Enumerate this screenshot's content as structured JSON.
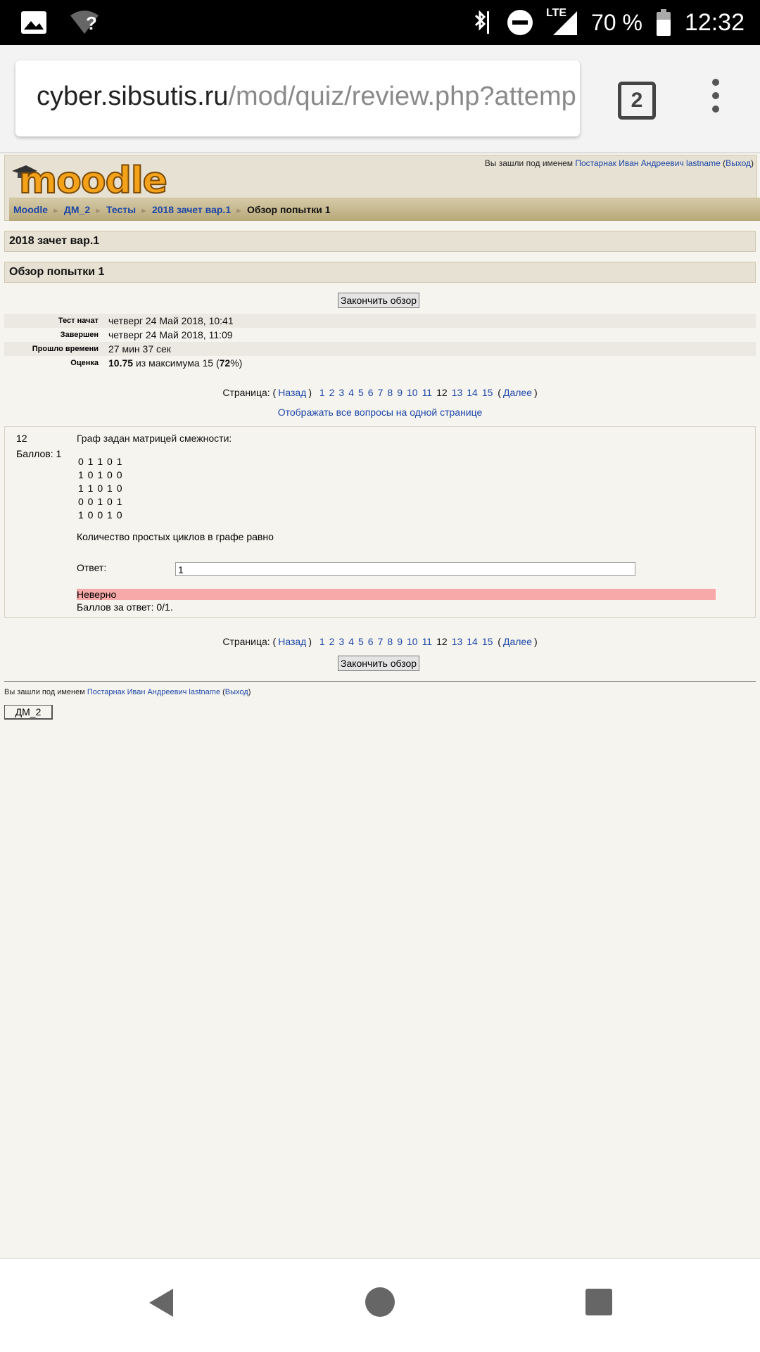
{
  "status_bar": {
    "battery": "70 %",
    "time": "12:32",
    "network": "LTE",
    "wifi_unknown": "?"
  },
  "browser": {
    "url_domain": "cyber.sibsutis.ru",
    "url_path": "/mod/quiz/review.php?attemp",
    "tab_count": "2"
  },
  "header": {
    "logo_text": "moodle",
    "login_prefix": "Вы зашли под именем",
    "user_name": "Постарнак Иван Андреевич lastname",
    "logout": "Выход"
  },
  "breadcrumb": [
    "Moodle",
    "ДМ_2",
    "Тесты",
    "2018 зачет вар.1",
    "Обзор попытки 1"
  ],
  "quiz_title": "2018 зачет вар.1",
  "attempt_title": "Обзор попытки 1",
  "finish_button": "Закончить обзор",
  "summary": [
    {
      "label": "Тест начат",
      "value": "четверг 24 Май 2018, 10:41"
    },
    {
      "label": "Завершен",
      "value": "четверг 24 Май 2018, 11:09"
    },
    {
      "label": "Прошло времени",
      "value": "27 мин 37 сек"
    },
    {
      "label": "Оценка",
      "grade": "10.75",
      "from": "из максимума 15 (",
      "pct": "72",
      "suffix": "%)"
    }
  ],
  "pager": {
    "label": "Страница:",
    "prev": "Назад",
    "next": "Далее",
    "pages": [
      "1",
      "2",
      "3",
      "4",
      "5",
      "6",
      "7",
      "8",
      "9",
      "10",
      "11",
      "12",
      "13",
      "14",
      "15"
    ],
    "current": "12"
  },
  "show_all": "Отображать все вопросы на одной странице",
  "question": {
    "number": "12",
    "marks": "Баллов: 1",
    "text": "Граф задан матрицей смежности:",
    "matrix": [
      "0 1 1 0 1",
      "1 0 1 0 0",
      "1 1 0 1 0",
      "0 0 1 0 1",
      "1 0 0 1 0"
    ],
    "prompt": "Количество простых циклов в графе равно",
    "answer_label": "Ответ:",
    "answer_value": "1",
    "feedback": "Неверно",
    "grade_text": "Баллов за ответ: 0/1."
  },
  "footer": {
    "login_prefix": "Вы зашли под именем",
    "user_name": "Постарнак Иван Андреевич lastname",
    "logout": "Выход",
    "course_button": "ДМ_2"
  }
}
